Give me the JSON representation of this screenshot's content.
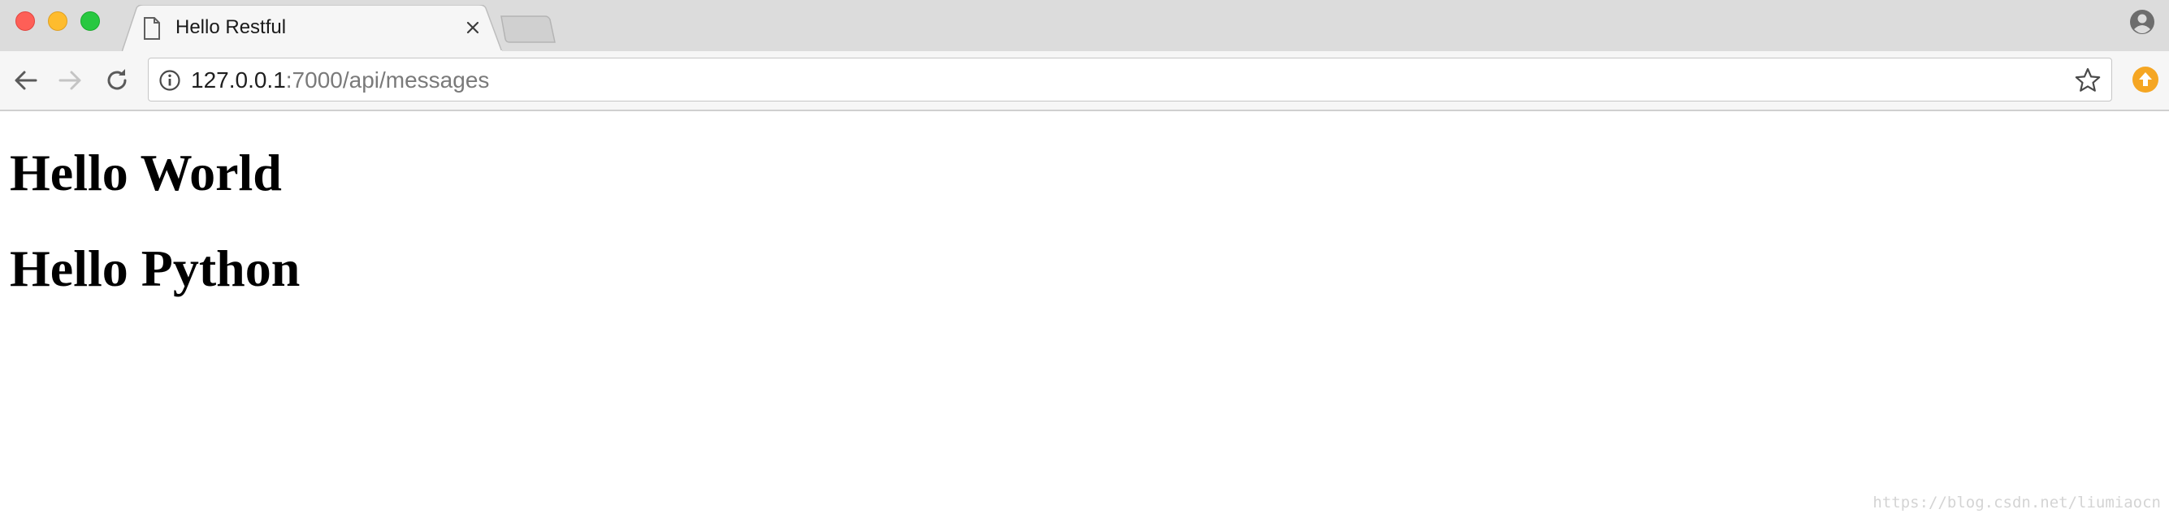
{
  "browser": {
    "tab": {
      "title": "Hello Restful"
    },
    "address_bar": {
      "host": "127.0.0.1",
      "rest": ":7000/api/messages"
    },
    "icons": {
      "page": "document-icon",
      "close": "close-icon",
      "back": "back-arrow-icon",
      "forward": "forward-arrow-icon",
      "reload": "reload-icon",
      "info": "info-icon",
      "bookmark": "star-icon",
      "extension": "upload-extension-icon",
      "profile": "profile-icon"
    },
    "colors": {
      "close_button": "#fe5f57",
      "minimize_button": "#febc2e",
      "maximize_button": "#28c840",
      "extension": "#f5a623"
    }
  },
  "page": {
    "headings": [
      "Hello World",
      "Hello Python"
    ],
    "watermark": "https://blog.csdn.net/liumiaocn"
  }
}
